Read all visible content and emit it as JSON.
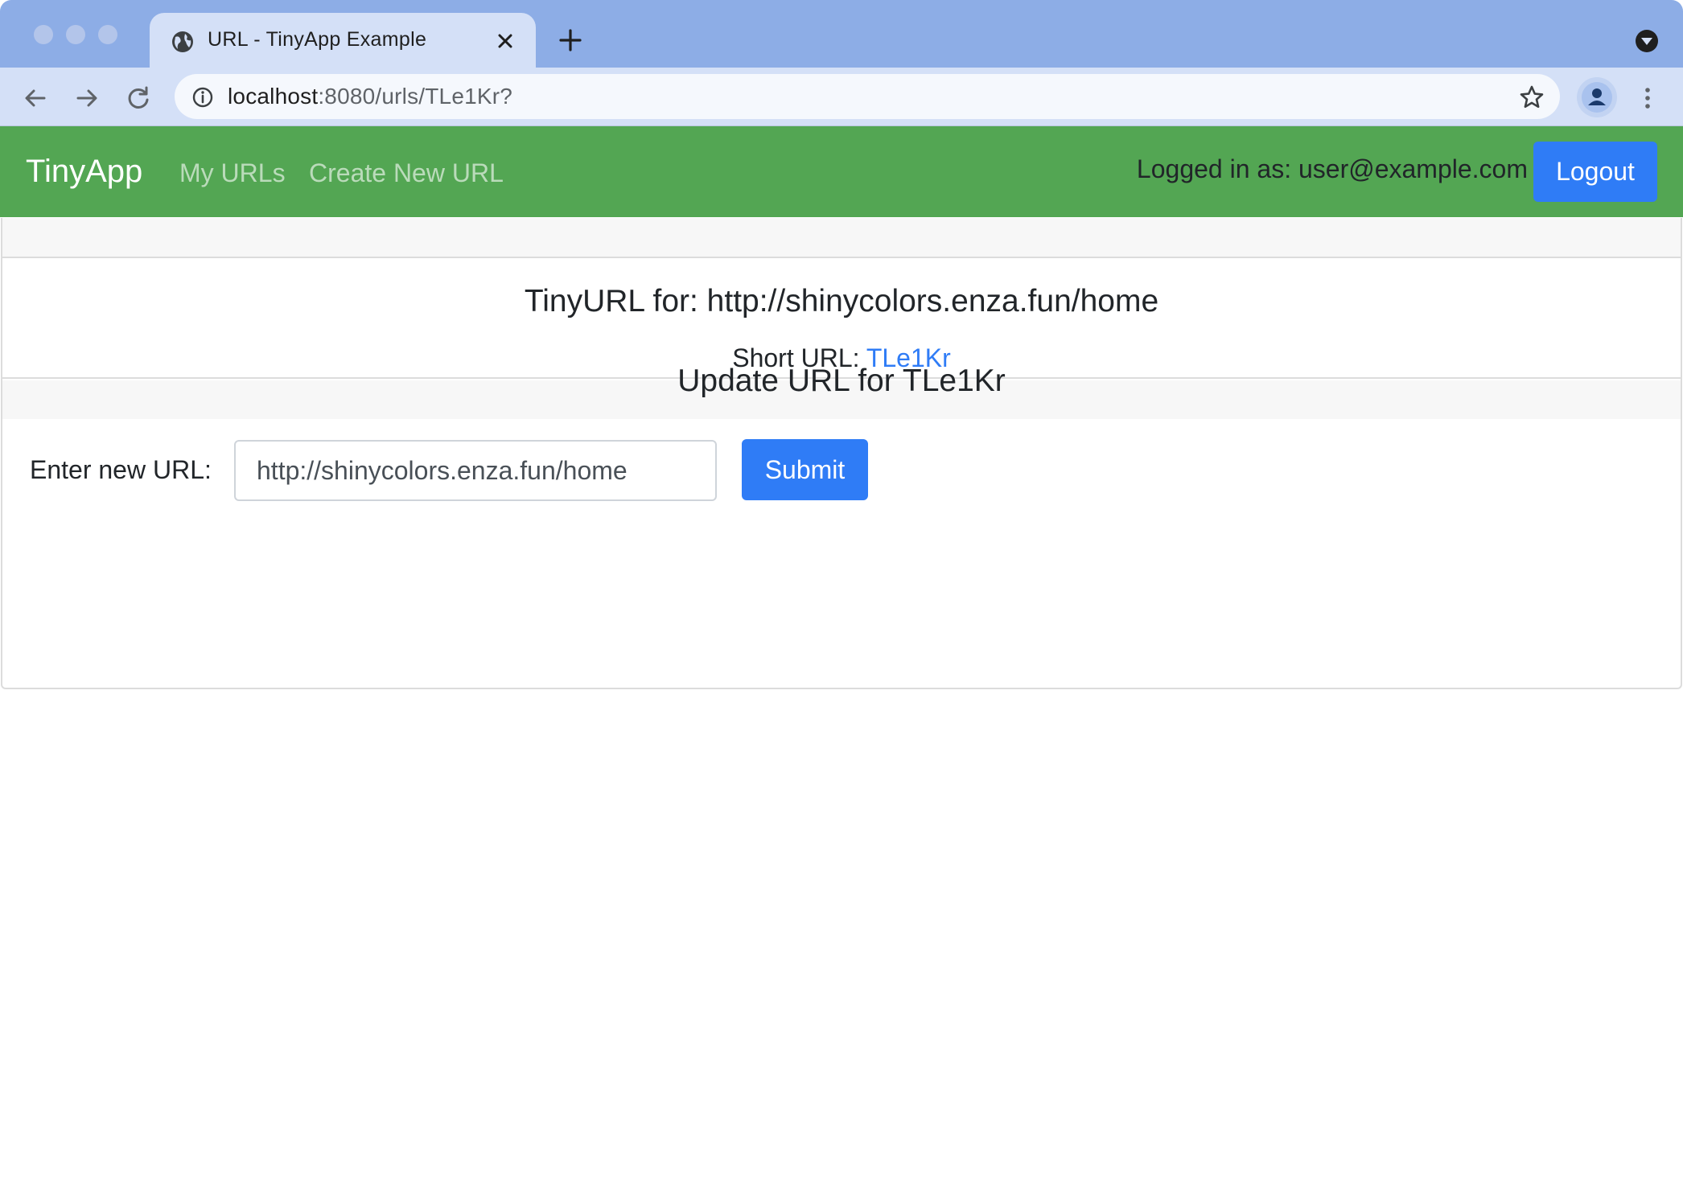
{
  "browser": {
    "tab_title": "URL - TinyApp Example",
    "url_host": "localhost",
    "url_path": ":8080/urls/TLe1Kr?",
    "icons": [
      "globe-icon",
      "close-icon",
      "plus-icon",
      "chevron-down-icon",
      "back-arrow-icon",
      "forward-arrow-icon",
      "reload-icon",
      "info-icon",
      "star-icon",
      "profile-icon",
      "more-vert-icon"
    ]
  },
  "navbar": {
    "brand": "TinyApp",
    "links": [
      "My URLs",
      "Create New URL"
    ],
    "logged_in_text": "Logged in as: user@example.com",
    "logout_label": "Logout",
    "color": "#53a653"
  },
  "detail": {
    "heading": "TinyURL for: http://shinycolors.enza.fun/home",
    "short_label": "Short URL: ",
    "short_id": "TLe1Kr"
  },
  "update": {
    "heading": "Update URL for TLe1Kr",
    "label": "Enter new URL:",
    "input_value": "http://shinycolors.enza.fun/home",
    "submit_label": "Submit",
    "accent": "#2f7cf6"
  }
}
